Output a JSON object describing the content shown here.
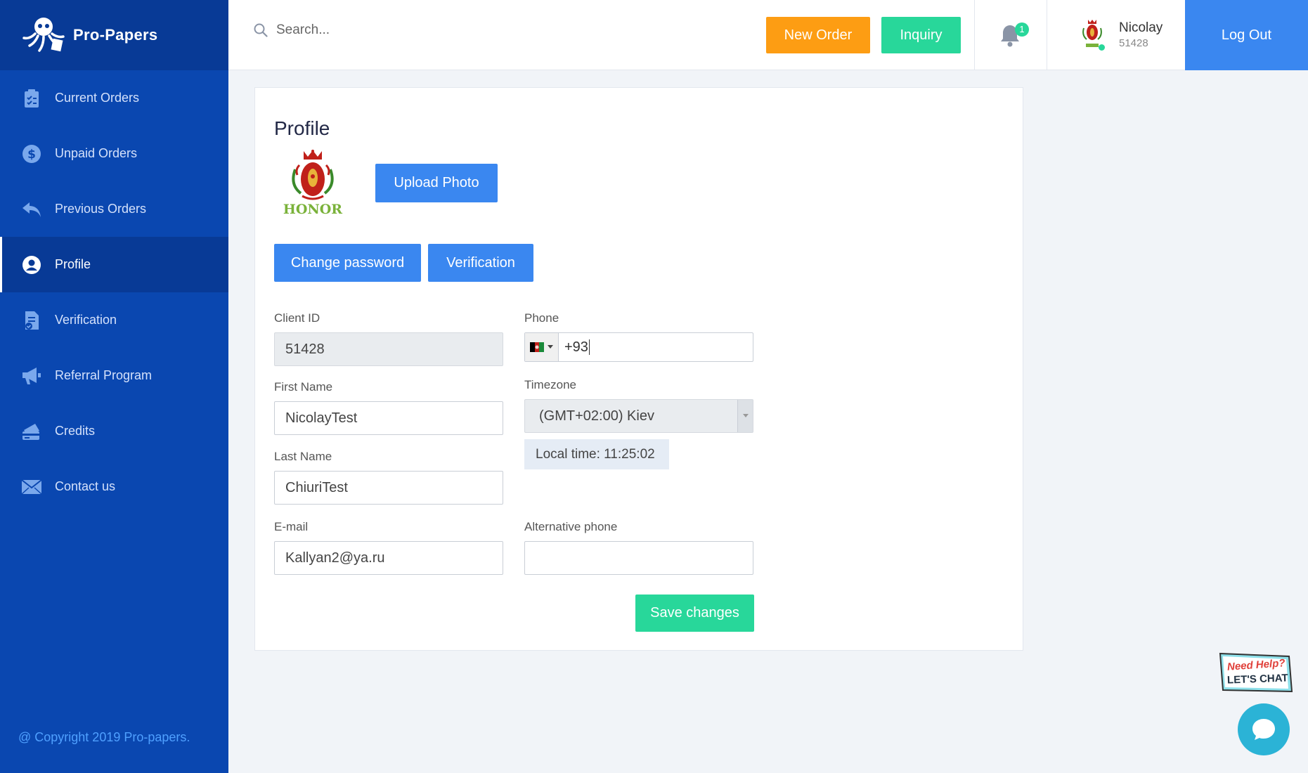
{
  "brand": {
    "name": "Pro-Papers",
    "logo_icon": "octopus-logo-icon"
  },
  "sidebar": {
    "items": [
      {
        "label": "Current Orders",
        "icon": "clipboard-icon",
        "active": false
      },
      {
        "label": "Unpaid Orders",
        "icon": "dollar-icon",
        "active": false
      },
      {
        "label": "Previous Orders",
        "icon": "reply-icon",
        "active": false
      },
      {
        "label": "Profile",
        "icon": "user-icon",
        "active": true
      },
      {
        "label": "Verification",
        "icon": "document-check-icon",
        "active": false
      },
      {
        "label": "Referral Program",
        "icon": "megaphone-icon",
        "active": false
      },
      {
        "label": "Credits",
        "icon": "credit-card-icon",
        "active": false
      },
      {
        "label": "Contact us",
        "icon": "envelope-icon",
        "active": false
      }
    ],
    "copyright": "@ Copyright 2019 Pro-papers."
  },
  "header": {
    "search_placeholder": "Search...",
    "new_order_label": "New Order",
    "inquiry_label": "Inquiry",
    "notification_count": "1",
    "user_name": "Nicolay",
    "user_id": "51428",
    "logout_label": "Log Out"
  },
  "profile": {
    "title": "Profile",
    "upload_photo_label": "Upload Photo",
    "change_password_label": "Change password",
    "verification_label": "Verification",
    "client_id_label": "Client ID",
    "client_id_value": "51428",
    "first_name_label": "First Name",
    "first_name_value": "NicolayTest",
    "last_name_label": "Last Name",
    "last_name_value": "ChiuriTest",
    "email_label": "E-mail",
    "email_value": "Kallyan2@ya.ru",
    "phone_label": "Phone",
    "phone_value": "+93",
    "timezone_label": "Timezone",
    "timezone_value": "(GMT+02:00) Kiev",
    "local_time": "Local time: 11:25:02",
    "alt_phone_label": "Alternative phone",
    "alt_phone_value": "",
    "save_label": "Save changes"
  },
  "chat": {
    "need_help_line1": "Need Help?",
    "need_help_line2": "LET'S CHAT"
  },
  "colors": {
    "sidebar": "#0a47b0",
    "brand_bg": "#083a96",
    "primary": "#3a87f0",
    "orange": "#fd9d13",
    "green": "#28d79a"
  }
}
